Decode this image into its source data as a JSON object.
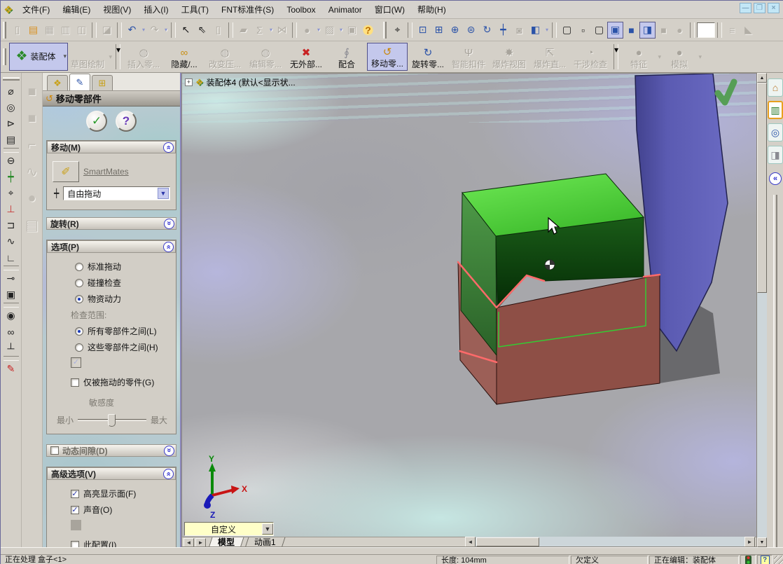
{
  "menu_bar": {
    "items": [
      {
        "name": "menu-file",
        "label": "文件(F)"
      },
      {
        "name": "menu-edit",
        "label": "编辑(E)"
      },
      {
        "name": "menu-view",
        "label": "视图(V)"
      },
      {
        "name": "menu-insert",
        "label": "插入(I)"
      },
      {
        "name": "menu-tools",
        "label": "工具(T)"
      },
      {
        "name": "menu-fnt-standard",
        "label": "FNT标准件(S)"
      },
      {
        "name": "menu-toolbox",
        "label": "Toolbox"
      },
      {
        "name": "menu-animator",
        "label": "Animator"
      },
      {
        "name": "menu-window",
        "label": "窗口(W)"
      },
      {
        "name": "menu-help",
        "label": "帮助(H)"
      }
    ]
  },
  "window_controls": {
    "minimize": "—",
    "restore": "❐",
    "close": "×"
  },
  "standard_toolbar": {
    "icons": [
      {
        "name": "new-document-icon",
        "glyph": "▯",
        "cls": "disabled"
      },
      {
        "name": "open-folder-icon",
        "glyph": "▤",
        "cls": "yellow"
      },
      {
        "name": "save-icon",
        "glyph": "▦",
        "cls": "disabled"
      },
      {
        "name": "print-icon",
        "glyph": "▥",
        "cls": "disabled"
      },
      {
        "name": "print-preview-icon",
        "glyph": "◫",
        "cls": "disabled"
      },
      {
        "name": "separator",
        "glyph": "",
        "cls": "sep"
      },
      {
        "name": "delete-icon",
        "glyph": "◪",
        "cls": "disabled"
      },
      {
        "name": "separator",
        "glyph": "",
        "cls": "sep"
      },
      {
        "name": "undo-icon",
        "glyph": "↶",
        "cls": "blue dd"
      },
      {
        "name": "redo-icon",
        "glyph": "↷",
        "cls": "disabled dd"
      },
      {
        "name": "separator",
        "glyph": "",
        "cls": "sep"
      },
      {
        "name": "select-icon",
        "glyph": "↖",
        "cls": "dark"
      },
      {
        "name": "selection-filter-icon",
        "glyph": "⇖",
        "cls": "dark"
      },
      {
        "name": "sketch-toggle-icon",
        "glyph": "▯",
        "cls": "disabled"
      },
      {
        "name": "separator",
        "glyph": "",
        "cls": "sep"
      },
      {
        "name": "rebuild-icon",
        "glyph": "▰",
        "cls": "disabled"
      },
      {
        "name": "equations-icon",
        "glyph": "Σ",
        "cls": "disabled dd"
      },
      {
        "name": "mirror-icon",
        "glyph": "⋈",
        "cls": "disabled"
      },
      {
        "name": "separator",
        "glyph": "",
        "cls": "sep"
      },
      {
        "name": "appearance-icon",
        "glyph": "●",
        "cls": "disabled dd"
      },
      {
        "name": "texture-icon",
        "glyph": "▨",
        "cls": "disabled dd"
      },
      {
        "name": "scene-icon",
        "glyph": "▣",
        "cls": "disabled"
      },
      {
        "name": "help-icon",
        "glyph": "?",
        "cls": "help"
      }
    ]
  },
  "view_toolbar": {
    "icons": [
      {
        "name": "viewport-select-icon",
        "glyph": "⌖",
        "cls": "dark"
      },
      {
        "name": "separator",
        "glyph": "",
        "cls": "sep"
      },
      {
        "name": "zoom-fit-icon",
        "glyph": "⊡",
        "cls": "blue"
      },
      {
        "name": "zoom-area-icon",
        "glyph": "⊞",
        "cls": "blue"
      },
      {
        "name": "zoom-in-out-icon",
        "glyph": "⊕",
        "cls": "blue"
      },
      {
        "name": "zoom-selection-icon",
        "glyph": "⊜",
        "cls": "blue"
      },
      {
        "name": "rotate-view-icon",
        "glyph": "↻",
        "cls": "blue"
      },
      {
        "name": "pan-icon",
        "glyph": "┿",
        "cls": "blue"
      },
      {
        "name": "previous-view-icon",
        "glyph": "◙",
        "cls": "disabled"
      },
      {
        "name": "view-orientation-icon",
        "glyph": "◧",
        "cls": "blue dd"
      },
      {
        "name": "separator",
        "glyph": "",
        "cls": "sep"
      },
      {
        "name": "wireframe-icon",
        "glyph": "▢",
        "cls": "dark"
      },
      {
        "name": "hidden-lines-visible-icon",
        "glyph": "▫",
        "cls": "dark"
      },
      {
        "name": "hidden-lines-removed-icon",
        "glyph": "▢",
        "cls": "dark"
      },
      {
        "name": "shaded-with-edges-icon",
        "glyph": "▣",
        "cls": "blue pressed"
      },
      {
        "name": "shaded-icon",
        "glyph": "■",
        "cls": "blue"
      },
      {
        "name": "perspective-icon",
        "glyph": "◨",
        "cls": "blue pressed"
      },
      {
        "name": "shadows-icon",
        "glyph": "■",
        "cls": "disabled"
      },
      {
        "name": "realview-icon",
        "glyph": "●",
        "cls": "disabled"
      },
      {
        "name": "separator",
        "glyph": "",
        "cls": "sep"
      },
      {
        "name": "empty-field",
        "glyph": "",
        "cls": "sunkenbox"
      },
      {
        "name": "separator",
        "glyph": "",
        "cls": "sep"
      },
      {
        "name": "animator-icon",
        "glyph": "≡",
        "cls": "disabled"
      },
      {
        "name": "capture-icon",
        "glyph": "◣",
        "cls": "disabled"
      }
    ]
  },
  "assembly_toolbar": {
    "buttons": [
      {
        "name": "assembly-button",
        "label": "装配体",
        "glyph": "❖",
        "color": "#2a8a2a",
        "cls": "pressed big dd"
      },
      {
        "name": "sketch-button",
        "label": "草图绘制",
        "glyph": "",
        "color": "",
        "cls": "disabled dd"
      },
      {
        "name": "separator",
        "label": "",
        "glyph": "",
        "cls": "sepv"
      },
      {
        "name": "insert-component-button",
        "label": "插入零...",
        "glyph": "◍",
        "color": "",
        "cls": "disabled"
      },
      {
        "name": "hide-show-component-button",
        "label": "隐藏/...",
        "glyph": "∞",
        "color": "#c89018",
        "cls": ""
      },
      {
        "name": "change-suppression-button",
        "label": "改变压...",
        "glyph": "◍",
        "color": "",
        "cls": "disabled"
      },
      {
        "name": "edit-component-button",
        "label": "编辑零...",
        "glyph": "◍",
        "color": "",
        "cls": "disabled"
      },
      {
        "name": "no-external-references-button",
        "label": "无外部...",
        "glyph": "✖",
        "color": "#c82222",
        "cls": ""
      },
      {
        "name": "mate-button",
        "label": "配合",
        "glyph": "∮",
        "color": "#8a8a92",
        "cls": ""
      },
      {
        "name": "move-component-button",
        "label": "移动零...",
        "glyph": "↺",
        "color": "#c8860a",
        "cls": "pressed"
      },
      {
        "name": "rotate-component-button",
        "label": "旋转零...",
        "glyph": "↻",
        "color": "#2a52a8",
        "cls": ""
      },
      {
        "name": "smart-fasteners-button",
        "label": "智能扣件",
        "glyph": "Ψ",
        "color": "",
        "cls": "disabled"
      },
      {
        "name": "exploded-view-button",
        "label": "爆炸视图",
        "glyph": "✸",
        "color": "",
        "cls": "disabled"
      },
      {
        "name": "explode-line-sketch-button",
        "label": "爆炸直...",
        "glyph": "⇱",
        "color": "",
        "cls": "disabled"
      },
      {
        "name": "interference-detection-button",
        "label": "干涉检查",
        "glyph": "◔",
        "color": "",
        "cls": "disabled"
      },
      {
        "name": "separator",
        "label": "",
        "glyph": "",
        "cls": "sepv"
      },
      {
        "name": "features-button",
        "label": "特征",
        "glyph": "●",
        "color": "",
        "cls": "disabled dd"
      },
      {
        "name": "simulation-button",
        "label": "模拟",
        "glyph": "●",
        "color": "",
        "cls": "disabled dd"
      }
    ]
  },
  "fastener_toolbar": {
    "icons": [
      {
        "name": "hex-bolt-icon",
        "glyph": "⌀",
        "color": "#222",
        "cls": ""
      },
      {
        "name": "nut-icon",
        "glyph": "◎",
        "color": "#222",
        "cls": ""
      },
      {
        "name": "screw-icon",
        "glyph": "⊳",
        "color": "#222",
        "cls": ""
      },
      {
        "name": "threaded-stud-icon",
        "glyph": "▤",
        "color": "#222",
        "cls": ""
      },
      {
        "name": "separator",
        "glyph": "",
        "color": "",
        "cls": "sep"
      },
      {
        "name": "washer-icon",
        "glyph": "⊖",
        "color": "#222",
        "cls": ""
      },
      {
        "name": "dowel-pin-icon",
        "glyph": "┿",
        "color": "#2a8a2a",
        "cls": ""
      },
      {
        "name": "pushpin-icon",
        "glyph": "⌖",
        "color": "#222",
        "cls": ""
      },
      {
        "name": "locating-pin-icon",
        "glyph": "⊥",
        "color": "#c83a3a",
        "cls": ""
      },
      {
        "name": "rivet-icon",
        "glyph": "⊐",
        "color": "#222",
        "cls": ""
      },
      {
        "name": "spring-icon",
        "glyph": "∿",
        "color": "#222",
        "cls": ""
      },
      {
        "name": "corner-bracket-icon",
        "glyph": "∟",
        "color": "#222",
        "cls": ""
      },
      {
        "name": "separator",
        "glyph": "",
        "color": "",
        "cls": "sep"
      },
      {
        "name": "small-bolt-icon",
        "glyph": "⊸",
        "color": "#222",
        "cls": ""
      },
      {
        "name": "bearing-mount-icon",
        "glyph": "▣",
        "color": "#222",
        "cls": ""
      },
      {
        "name": "separator",
        "glyph": "",
        "color": "",
        "cls": "sep"
      },
      {
        "name": "coil-icon",
        "glyph": "◉",
        "color": "#222",
        "cls": ""
      },
      {
        "name": "chain-link-icon",
        "glyph": "∞",
        "color": "#222",
        "cls": ""
      },
      {
        "name": "t-bolt-icon",
        "glyph": "┴",
        "color": "#222",
        "cls": ""
      },
      {
        "name": "separator",
        "glyph": "",
        "color": "",
        "cls": "sep"
      },
      {
        "name": "screwdriver-icon",
        "glyph": "✎",
        "color": "#c82222",
        "cls": ""
      }
    ]
  },
  "sketch_toolbar_disabled": {
    "icons": [
      {
        "name": "sketch-tool-icon",
        "glyph": "■",
        "cls": "disabled"
      },
      {
        "name": "sketch-tool-icon",
        "glyph": "■",
        "cls": "disabled"
      },
      {
        "name": "spline-tool-icon",
        "glyph": "⌐",
        "cls": "disabled"
      },
      {
        "name": "curve-tool-icon",
        "glyph": "∿",
        "cls": "disabled"
      },
      {
        "name": "ellipse-tool-icon",
        "glyph": "●",
        "cls": "disabled"
      },
      {
        "name": "pattern-tool-icon",
        "glyph": "▤",
        "cls": "disabled"
      }
    ]
  },
  "property_manager": {
    "title": "移动零部件",
    "move_group": {
      "label": "移动(M)",
      "smartmates_label": "SmartMates",
      "drag_value": "自由拖动"
    },
    "rotate_group": {
      "label": "旋转(R)"
    },
    "options_group": {
      "label": "选项(P)",
      "radio_standard": "标准拖动",
      "radio_collision": "碰撞检查",
      "radio_physical": "物资动力",
      "scope_label": "检查范围:",
      "radio_all_components": "所有零部件之间(L)",
      "radio_these_components": "这些零部件之间(H)",
      "check_dragged_only": "仅被拖动的零件(G)",
      "sensitivity_label": "敏感度",
      "min_label": "最小",
      "max_label": "最大"
    },
    "dynamic_group": {
      "label": "动态间隙(D)"
    },
    "advanced_group": {
      "label": "高级选项(V)",
      "check_highlight": "高亮显示面(F)",
      "check_sound": "声音(O)",
      "check_this_config": "此配置(I)"
    }
  },
  "viewport": {
    "tree_label": "装配体4 (默认<显示状...",
    "plus_glyph": "+",
    "combo_value": "自定义",
    "model_tab": "模型",
    "animation_tab": "动画1",
    "triad": {
      "x": "X",
      "y": "Y",
      "z": "Z"
    }
  },
  "task_pane": {
    "icons": [
      {
        "name": "solidworks-resources-icon",
        "glyph": "⌂",
        "color": "#b8762a",
        "cls": ""
      },
      {
        "name": "design-library-icon",
        "glyph": "▥",
        "color": "#2a7a2a",
        "cls": "selected"
      },
      {
        "name": "file-explorer-icon",
        "glyph": "◎",
        "color": "#2a52a8",
        "cls": ""
      },
      {
        "name": "drag-drop-palette-icon",
        "glyph": "◨",
        "color": "#8a8a92",
        "cls": ""
      }
    ],
    "collapse_glyph": "«"
  },
  "status_bar": {
    "processing": "正在处理 盒子<1>",
    "length": "长度: 104mm",
    "definition": "欠定义",
    "editing": "正在编辑：装配体"
  },
  "colors": {
    "lid_green_top": "#58da3e",
    "lid_green_front": "#073a08",
    "lid_green_left": "#3a7c38",
    "tray_brown_front": "#8e4f46",
    "tray_brown_left": "#9c5f57",
    "panel_purple": "#5b5bb2",
    "highlight_red": "#ff6a6a",
    "hidden_edge_green": "#33cc33",
    "selection_lavender": "#c4c8ec"
  }
}
